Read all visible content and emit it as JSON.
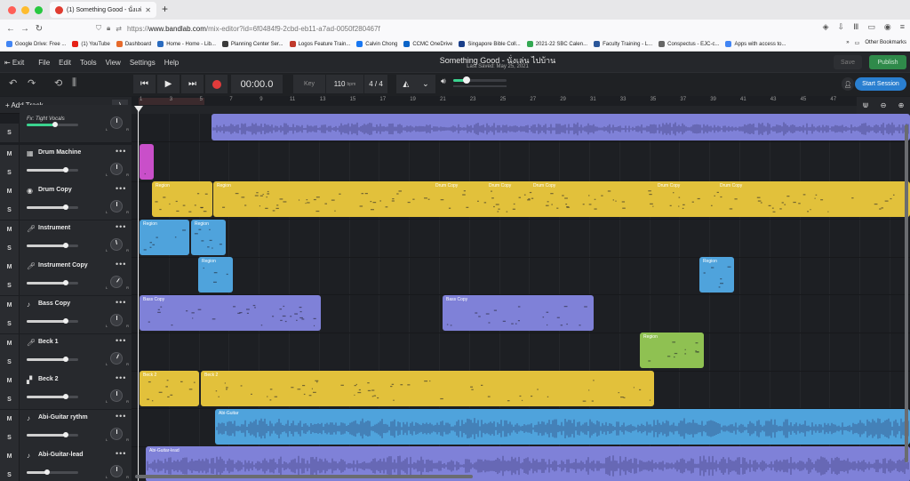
{
  "browser": {
    "tab_title": "(1) Something Good - นั่งเล่น ไปบ้าน",
    "url_prefix": "https://",
    "url_domain": "www.bandlab.com",
    "url_path": "/mix-editor?id=6f0484f9-2cbd-eb11-a7ad-0050f280467f",
    "bookmarks": [
      {
        "label": "Google Drive: Free ...",
        "color": "#4285f4"
      },
      {
        "label": "(1) YouTube",
        "color": "#e62117"
      },
      {
        "label": "Dashboard",
        "color": "#e66a2c"
      },
      {
        "label": "Home - Home - Lib...",
        "color": "#2a6bbf"
      },
      {
        "label": "Planning Center Ser...",
        "color": "#3a3a3a"
      },
      {
        "label": "Logos Feature Train...",
        "color": "#c0392b"
      },
      {
        "label": "Calvin Chong",
        "color": "#1877f2"
      },
      {
        "label": "CCMC OneDrive",
        "color": "#0a64c8"
      },
      {
        "label": "Singapore Bible Coll...",
        "color": "#1a3f8a"
      },
      {
        "label": "2021-22 SBC Calen...",
        "color": "#34a853"
      },
      {
        "label": "Faculty Training - L...",
        "color": "#2b579a"
      },
      {
        "label": "Conspectus - EJC-c...",
        "color": "#666666"
      },
      {
        "label": "Apps with access to...",
        "color": "#4285f4"
      }
    ],
    "other_bookmarks": "Other Bookmarks"
  },
  "app": {
    "menu": [
      "Exit",
      "File",
      "Edit",
      "Tools",
      "View",
      "Settings",
      "Help"
    ],
    "song_title": "Something Good - นั่งเล่น ไปบ้าน",
    "last_saved": "Last Saved: May 25, 2021",
    "save_label": "Save",
    "publish_label": "Publish",
    "start_session_label": "Start Session",
    "time": "00:00.0",
    "key_label": "Key",
    "tempo": "110",
    "tempo_unit": "bpm",
    "time_signature": "4 / 4",
    "master_volume": 0.25,
    "add_track_label": "Add Track",
    "ruler_numbers": [
      "1",
      "3",
      "5",
      "7",
      "9",
      "11",
      "13",
      "15",
      "17",
      "19",
      "21",
      "23",
      "25",
      "27",
      "29",
      "31",
      "33",
      "35",
      "37",
      "39",
      "41",
      "43",
      "45",
      "47"
    ]
  },
  "tracks": [
    {
      "name": "",
      "fx": "Fx: Tight Vocals",
      "icon": "mic-icon",
      "volume": 0.55,
      "pan": 0.5,
      "has_mute": false
    },
    {
      "name": "Drum Machine",
      "icon": "drum-machine-icon",
      "volume": 0.75,
      "pan": 0.5,
      "has_mute": true
    },
    {
      "name": "Drum Copy",
      "icon": "drum-icon",
      "volume": 0.75,
      "pan": 0.5,
      "has_mute": true
    },
    {
      "name": "Instrument",
      "icon": "mic-icon",
      "volume": 0.75,
      "pan": 0.45,
      "has_mute": true
    },
    {
      "name": "Instrument Copy",
      "icon": "mic-icon",
      "volume": 0.75,
      "pan": 0.65,
      "has_mute": true
    },
    {
      "name": "Bass Copy",
      "icon": "guitar-icon",
      "volume": 0.75,
      "pan": 0.5,
      "has_mute": true
    },
    {
      "name": "Beck 1",
      "icon": "mic-icon",
      "volume": 0.75,
      "pan": 0.6,
      "has_mute": true
    },
    {
      "name": "Beck 2",
      "icon": "piano-icon",
      "volume": 0.75,
      "pan": 0.5,
      "has_mute": true
    },
    {
      "name": "Abi-Guitar rythm",
      "icon": "guitar-icon",
      "volume": 0.75,
      "pan": 0.5,
      "has_mute": true
    },
    {
      "name": "Abi-Guitar-lead",
      "icon": "guitar-icon",
      "volume": 0.4,
      "pan": 0.5,
      "has_mute": true
    }
  ],
  "regions": [
    {
      "lane": 0,
      "label": "",
      "color": "#7f81d8",
      "kind": "audio"
    },
    {
      "lane": 1,
      "label": "",
      "color": "#c94fc9",
      "kind": "midi"
    },
    {
      "lane": 2,
      "label": "Region",
      "color": "#e2c13b",
      "kind": "midi"
    },
    {
      "lane": 2,
      "label": "Region",
      "color": "#e2c13b",
      "kind": "midi"
    },
    {
      "lane": 3,
      "label": "Region",
      "color": "#4fa3dc",
      "kind": "midi"
    },
    {
      "lane": 3,
      "label": "Region",
      "color": "#4fa3dc",
      "kind": "midi"
    },
    {
      "lane": 4,
      "label": "Region",
      "color": "#4fa3dc",
      "kind": "midi"
    },
    {
      "lane": 4,
      "label": "Region",
      "color": "#4fa3dc",
      "kind": "midi"
    },
    {
      "lane": 5,
      "label": "Bass Copy",
      "color": "#7f81d8",
      "kind": "midi"
    },
    {
      "lane": 5,
      "label": "Bass Copy",
      "color": "#7f81d8",
      "kind": "midi"
    },
    {
      "lane": 6,
      "label": "Region",
      "color": "#8fc152",
      "kind": "midi"
    },
    {
      "lane": 7,
      "label": "Beck 2",
      "color": "#e2c13b",
      "kind": "midi"
    },
    {
      "lane": 7,
      "label": "Beck 2",
      "color": "#e2c13b",
      "kind": "midi"
    },
    {
      "lane": 8,
      "label": "Abi-Guitar",
      "color": "#4fa3dc",
      "kind": "audio"
    },
    {
      "lane": 9,
      "label": "Abi-Guitar-lead",
      "color": "#7f81d8",
      "kind": "audio"
    }
  ],
  "drum_copy_sublabels": [
    "Drum Copy",
    "Drum Copy",
    "Drum Copy",
    "Drum Copy",
    "Drum Copy"
  ]
}
